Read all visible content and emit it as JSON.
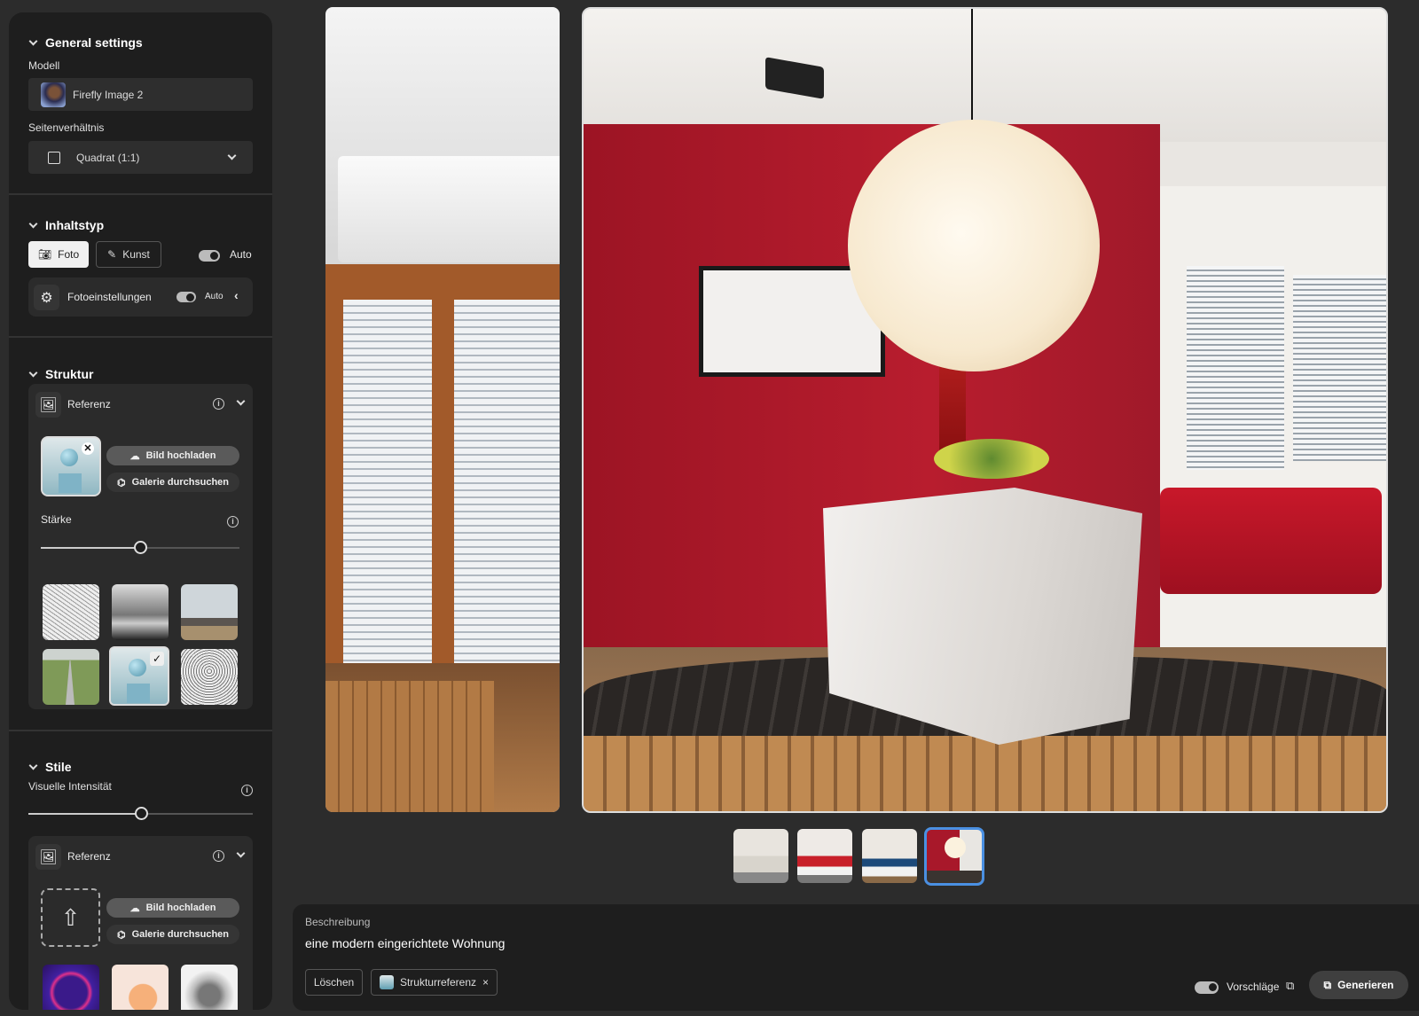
{
  "sidebar": {
    "general": {
      "title": "General settings",
      "model_label": "Modell",
      "model_value": "Firefly Image 2",
      "aspect_label": "Seitenverhältnis",
      "aspect_value": "Quadrat (1:1)"
    },
    "content_type": {
      "title": "Inhaltstyp",
      "photo": "Foto",
      "art": "Kunst",
      "auto": "Auto",
      "auto_on": true,
      "photo_settings": "Fotoeinstellungen",
      "photo_settings_auto": "Auto"
    },
    "structure": {
      "title": "Struktur",
      "reference": "Referenz",
      "upload": "Bild hochladen",
      "browse": "Galerie durchsuchen",
      "strength_label": "Stärke",
      "strength_value": 0.5,
      "presets": [
        "bird-sketch",
        "misty-river",
        "living-room",
        "green-road",
        "sphere-cube",
        "owl-drawing"
      ],
      "selected_preset": 4
    },
    "styles": {
      "title": "Stile",
      "intensity_label": "Visuelle Intensität",
      "intensity_value": 0.5,
      "reference": "Referenz",
      "upload": "Bild hochladen",
      "browse": "Galerie durchsuchen"
    }
  },
  "gallery": {
    "thumbnail_count": 4,
    "selected": 3
  },
  "prompt": {
    "label": "Beschreibung",
    "text": "eine modern eingerichtete Wohnung",
    "clear": "Löschen",
    "chip": "Strukturreferenz",
    "chip_close": "×",
    "suggestions": "Vorschläge",
    "suggestions_on": true,
    "generate": "Generieren"
  },
  "colors": {
    "accent": "#4a90e2",
    "wall_red": "#a8182a",
    "panel": "#1e1e1e",
    "bg": "#2c2c2c"
  }
}
